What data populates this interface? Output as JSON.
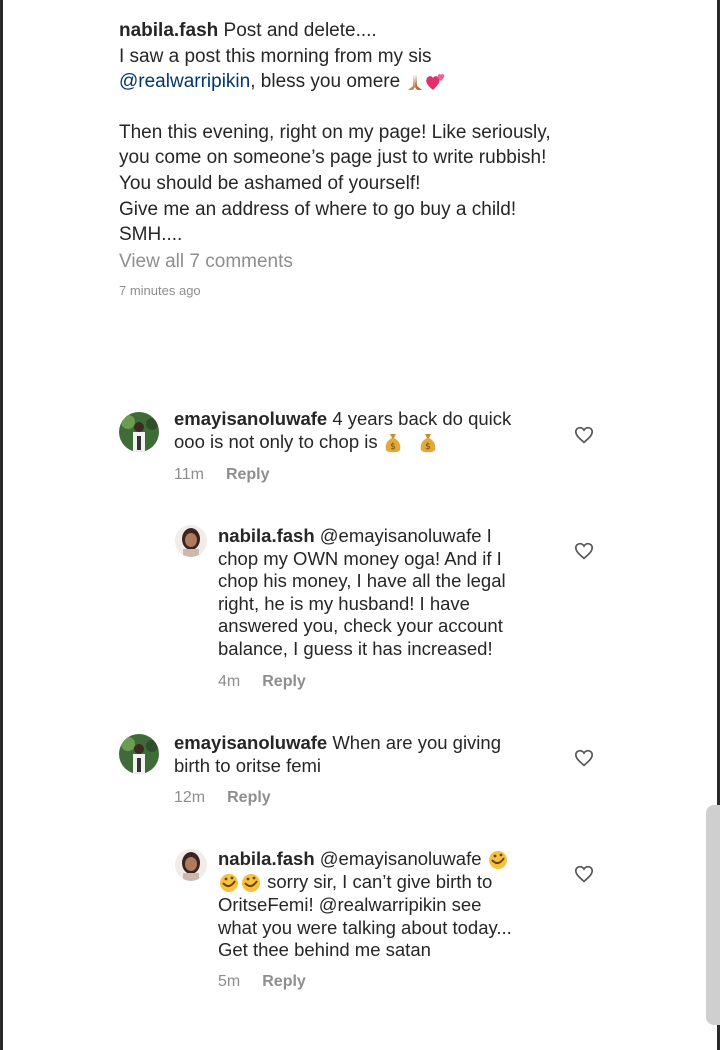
{
  "post": {
    "username": "nabila.fash",
    "caption_first": "Post and delete....",
    "caption_line2": "I saw a post this morning from my sis",
    "mention": "@realwarripikin",
    "mention_suffix": ", bless you omere",
    "caption_line3": "Then this evening, right on my page! Like seriously,",
    "caption_line4": "you come on someone’s page just to write rubbish!",
    "caption_line5": "You should be ashamed of yourself!",
    "caption_line6": "Give me an address of where to go buy a child!",
    "caption_line7": "SMH....",
    "view_all": "View all 7 comments",
    "time_ago": "7 minutes ago"
  },
  "comments": [
    {
      "username": "emayisanoluwafe",
      "line1": "4 years back do quick",
      "line2": "ooo is not only to chop is",
      "time": "11m",
      "reply": "Reply"
    },
    {
      "username": "nabila.fash",
      "mention": "@emayisanoluwafe",
      "line1_tail": "I",
      "line2": "chop my OWN money oga! And if I",
      "line3": "chop his money, I have all the legal",
      "line4": "right, he is my husband! I have",
      "line5": "answered you, check your account",
      "line6": "balance, I guess it has increased!",
      "time": "4m",
      "reply": "Reply"
    },
    {
      "username": "emayisanoluwafe",
      "line1": "When are you giving",
      "line2": "birth to oritse femi",
      "time": "12m",
      "reply": "Reply"
    },
    {
      "username": "nabila.fash",
      "mention": "@emayisanoluwafe",
      "line2_tail": "sorry sir, I can’t give birth to",
      "line3": "OritseFemi!",
      "mention2": "@realwarripikin",
      "line3_tail": "see",
      "line4": "what you were talking about today...",
      "line5": "Get thee behind me satan",
      "time": "5m",
      "reply": "Reply"
    }
  ],
  "colors": {
    "text": "#262626",
    "secondary": "#8e8e8e",
    "mention": "#00376b"
  },
  "icons": [
    "heart-icon",
    "money-bag-icon",
    "rofl-emoji-icon",
    "praying-hands-icon",
    "two-hearts-icon"
  ]
}
